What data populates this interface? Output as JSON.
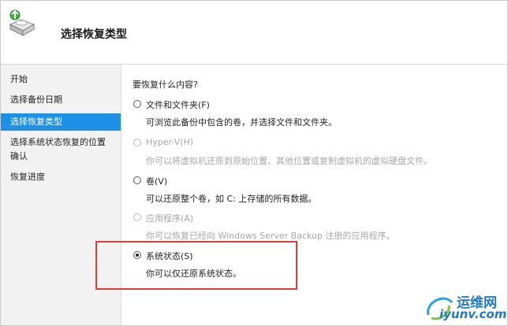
{
  "header": {
    "title": "选择恢复类型",
    "icon": "backup-restore-icon"
  },
  "sidebar": {
    "items": [
      {
        "label": "开始",
        "active": false
      },
      {
        "label": "选择备份日期",
        "active": false
      },
      {
        "label": "选择恢复类型",
        "active": true
      },
      {
        "label": "选择系统状态恢复的位置",
        "active": false
      },
      {
        "label": "确认",
        "active": false
      },
      {
        "label": "恢复进度",
        "active": false
      }
    ]
  },
  "main": {
    "question": "要恢复什么内容?",
    "options": [
      {
        "label": "文件和文件夹(F)",
        "description": "可浏览此备份中包含的卷，并选择文件和文件夹。",
        "enabled": true,
        "checked": false
      },
      {
        "label": "Hyper-V(H)",
        "description": "你可以将虚拟机还原到原始位置、其他位置或复制虚拟机的虚拟硬盘文件。",
        "enabled": false,
        "checked": false
      },
      {
        "label": "卷(V)",
        "description": "可以还原整个卷，如 C: 上存储的所有数据。",
        "enabled": true,
        "checked": false
      },
      {
        "label": "应用程序(A)",
        "description": "你可以恢复已经向 Windows Server Backup 注册的应用程序。",
        "enabled": false,
        "checked": false
      },
      {
        "label": "系统状态(S)",
        "description": "你可以仅还原系统状态。",
        "enabled": true,
        "checked": true
      }
    ]
  },
  "watermark": {
    "text_cn": "运维网",
    "text_en": "iyunv.com"
  },
  "colors": {
    "accent": "#1e90e6",
    "highlight": "#e03a3a",
    "watermark": "#1f7ac4"
  }
}
